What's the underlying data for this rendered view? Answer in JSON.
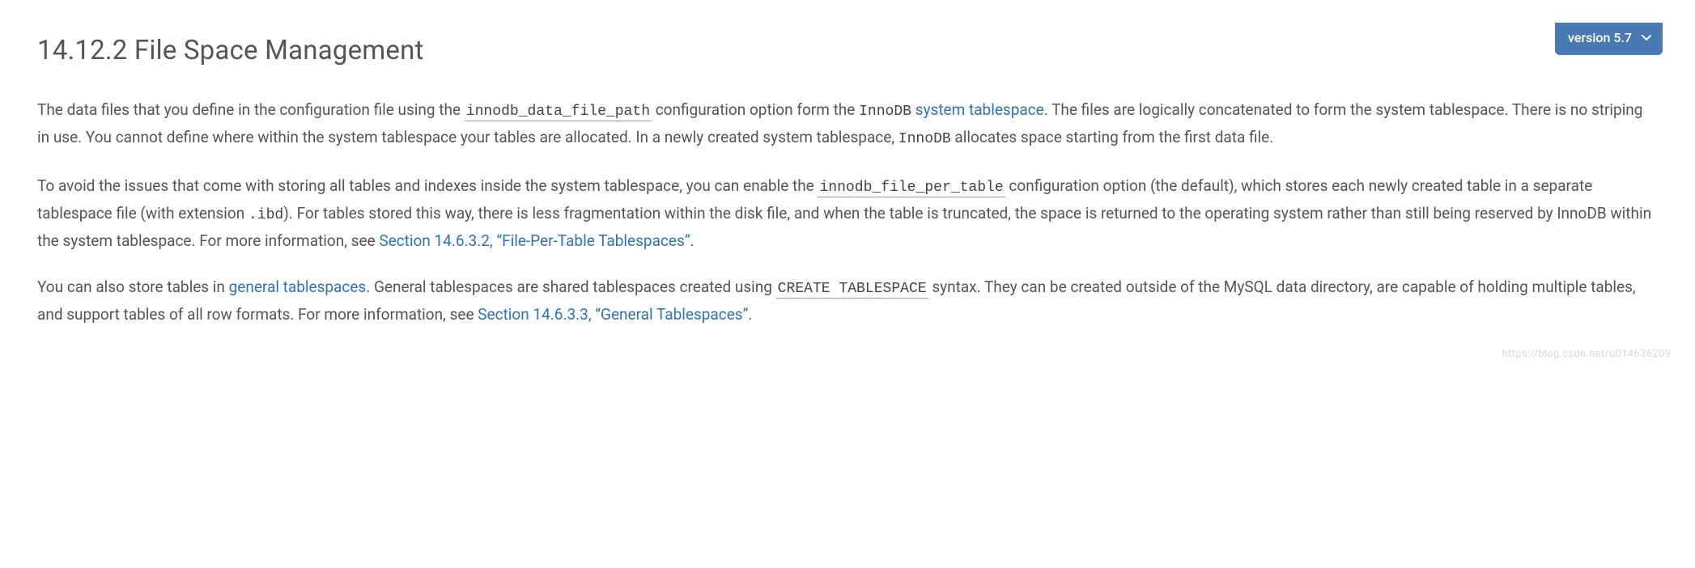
{
  "version_selector": {
    "label": "version 5.7"
  },
  "heading": "14.12.2 File Space Management",
  "p1": {
    "t1": "The data files that you define in the configuration file using the ",
    "code1": "innodb_data_file_path",
    "t2": " configuration option form the ",
    "code2": "InnoDB",
    "t3": " ",
    "link1": "system tablespace",
    "t4": ". The files are logically concatenated to form the system tablespace. There is no striping in use. You cannot define where within the system tablespace your tables are allocated. In a newly created system tablespace, ",
    "code3": "InnoDB",
    "t5": " allocates space starting from the first data file."
  },
  "p2": {
    "t1": "To avoid the issues that come with storing all tables and indexes inside the system tablespace, you can enable the ",
    "code1": "innodb_file_per_table",
    "t2": " configuration option (the default), which stores each newly created table in a separate tablespace file (with extension ",
    "code2": ".ibd",
    "t3": "). For tables stored this way, there is less fragmentation within the disk file, and when the table is truncated, the space is returned to the operating system rather than still being reserved by InnoDB within the system tablespace. For more information, see ",
    "link1": "Section 14.6.3.2, “File-Per-Table Tablespaces”",
    "t4": "."
  },
  "p3": {
    "t1": "You can also store tables in ",
    "link1": "general tablespaces",
    "t2": ". General tablespaces are shared tablespaces created using ",
    "code1": "CREATE TABLESPACE",
    "t3": " syntax. They can be created outside of the MySQL data directory, are capable of holding multiple tables, and support tables of all row formats. For more information, see ",
    "link2": "Section 14.6.3.3, “General Tablespaces”",
    "t4": "."
  },
  "watermark": "https://blog.csdn.net/u014636209"
}
